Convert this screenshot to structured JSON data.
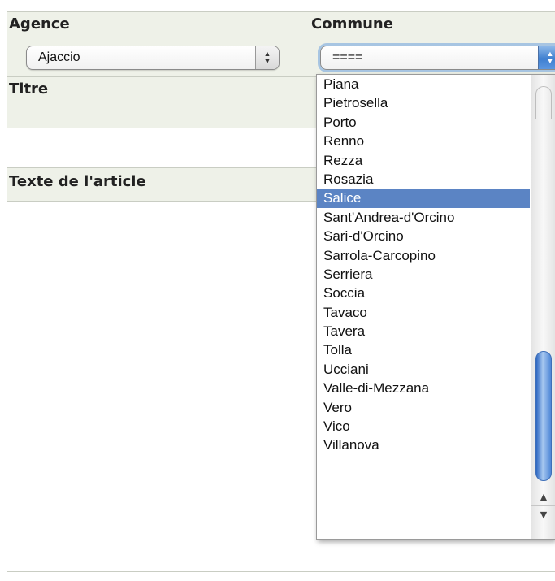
{
  "form": {
    "agence_label": "Agence",
    "agence_value": "Ajaccio",
    "commune_label": "Commune",
    "commune_value": "====",
    "titre_label": "Titre",
    "texte_label": "Texte de l'article"
  },
  "commune_dropdown": {
    "options": [
      "Piana",
      "Pietrosella",
      "Porto",
      "Renno",
      "Rezza",
      "Rosazia",
      "Salice",
      "Sant'Andrea-d'Orcino",
      "Sari-d'Orcino",
      "Sarrola-Carcopino",
      "Serriera",
      "Soccia",
      "Tavaco",
      "Tavera",
      "Tolla",
      "Ucciani",
      "Valle-di-Mezzana",
      "Vero",
      "Vico",
      "Villanova"
    ],
    "highlighted": "Salice"
  },
  "icons": {
    "select_arrows": "up-down-arrows-icon",
    "scroll_up": "scroll-up-arrow-icon",
    "scroll_down": "scroll-down-arrow-icon"
  },
  "colors": {
    "cell_background": "#eef1e8",
    "highlight": "#5b84c4",
    "select_accent": "#3f7fd0"
  }
}
